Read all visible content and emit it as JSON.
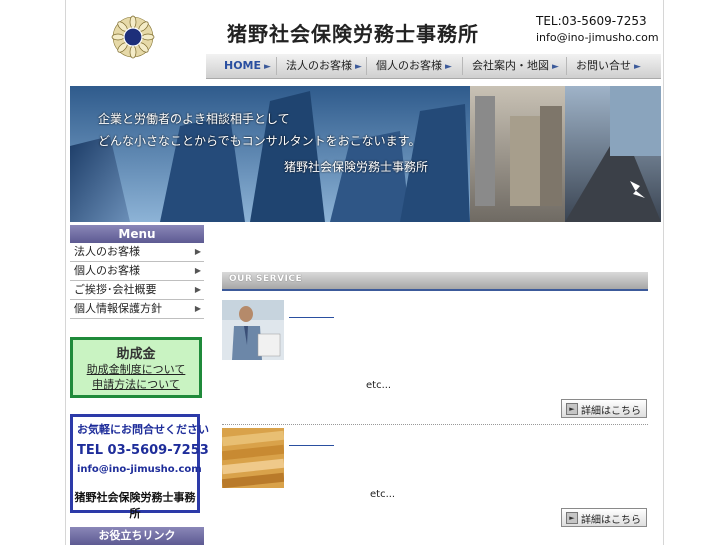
{
  "header": {
    "title": "猪野社会保険労務士事務所",
    "tel": "TEL:03-5609-7253",
    "email": "info@ino-jimusho.com",
    "logo_text": "SR"
  },
  "nav": {
    "items": [
      {
        "label": "HOME",
        "active": true
      },
      {
        "label": "法人のお客様",
        "active": false
      },
      {
        "label": "個人のお客様",
        "active": false
      },
      {
        "label": "会社案内・地図",
        "active": false
      },
      {
        "label": "お問い合せ",
        "active": false
      }
    ]
  },
  "hero": {
    "line1": "企業と労働者のよき相談相手として",
    "line2": "どんな小さなことからでもコンサルタントをおこないます。",
    "office": "猪野社会保険労務士事務所"
  },
  "sidebar": {
    "menu_title": "Menu",
    "items": [
      {
        "label": "法人のお客様"
      },
      {
        "label": "個人のお客様"
      },
      {
        "label": "ご挨拶･会社概要"
      },
      {
        "label": "個人情報保護方針"
      }
    ],
    "grant": {
      "title": "助成金",
      "link1": "助成金制度について",
      "link2": "申請方法について"
    },
    "contact": {
      "line1": "お気軽にお問合せください",
      "tel": "TEL 03-5609-7253",
      "email": "info@ino-jimusho.com",
      "office": "猪野社会保険労務士事務所"
    },
    "links_title": "お役立ちリンク"
  },
  "main": {
    "service_heading": "OUR SERVICE",
    "services": [
      {
        "etc": "etc...",
        "button": "詳細はこちら"
      },
      {
        "etc": "etc...",
        "button": "詳細はこちら"
      }
    ]
  },
  "colors": {
    "accent": "#3c5a9a",
    "menu_header": "#6b68a0",
    "grant_bg": "#c9f3c2",
    "grant_border": "#1f8a3a",
    "contact_border": "#2c3aa8"
  }
}
